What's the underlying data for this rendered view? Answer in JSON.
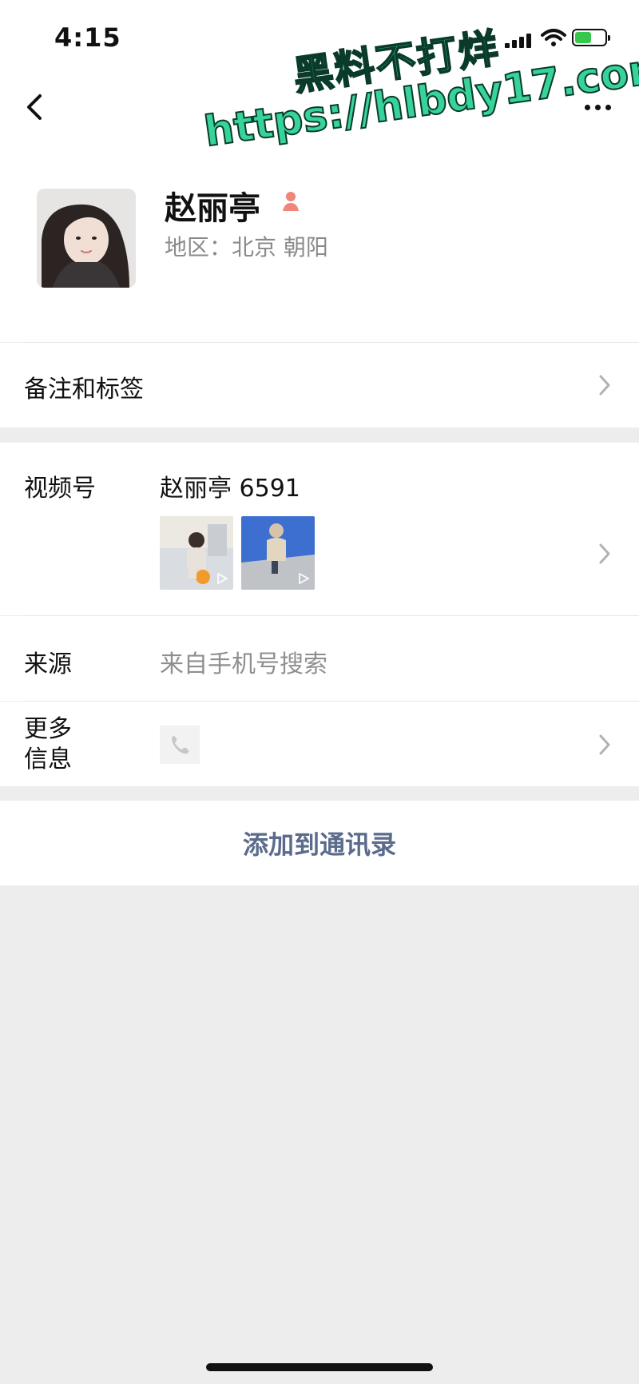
{
  "status_bar": {
    "time": "4:15"
  },
  "watermark": {
    "line1": "黑料不打烊",
    "line2": "https://hlbdy17.com"
  },
  "profile": {
    "name": "赵丽亭",
    "region": "地区：北京 朝阳"
  },
  "cells": {
    "remarks_tags": "备注和标签",
    "channels_label": "视频号",
    "channels_name": "赵丽亭 6591",
    "source_label": "来源",
    "source_value": "来自手机号搜索",
    "more_info_label_line1": "更多",
    "more_info_label_line2": "信息"
  },
  "actions": {
    "add_to_contacts": "添加到通讯录"
  },
  "icons": {
    "back": "back-icon",
    "more": "more-icon",
    "gender": "female-user-icon",
    "chevron": "chevron-right-icon",
    "phone": "phone-icon",
    "play": "play-icon"
  },
  "colors": {
    "accent_link": "#5a6b8c",
    "watermark_fill": "#37d39a",
    "gender_icon": "#f0857a"
  }
}
